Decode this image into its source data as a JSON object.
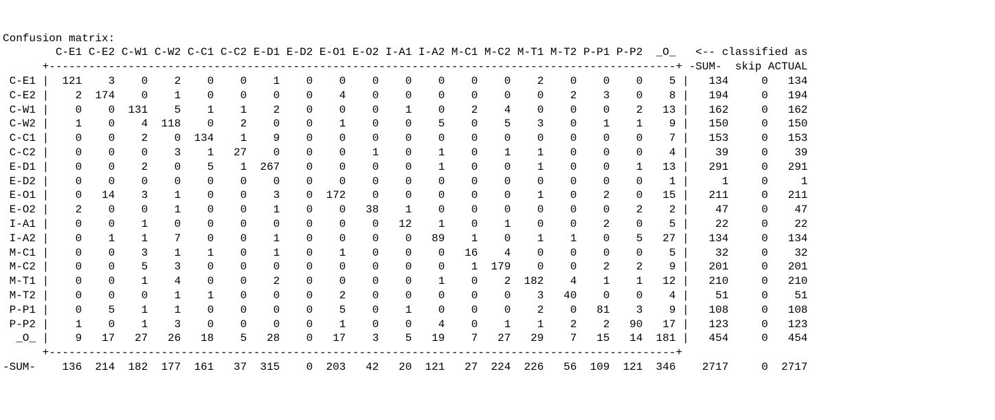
{
  "title": "Confusion matrix:",
  "classified_as": "<-- classified as",
  "col_labels": [
    "C-E1",
    "C-E2",
    "C-W1",
    "C-W2",
    "C-C1",
    "C-C2",
    "E-D1",
    "E-D2",
    "E-O1",
    "E-O2",
    "I-A1",
    "I-A2",
    "M-C1",
    "M-C2",
    "M-T1",
    "M-T2",
    "P-P1",
    "P-P2",
    "_O_"
  ],
  "sum_cols": [
    "-SUM-",
    "skip",
    "ACTUAL"
  ],
  "row_labels": [
    "C-E1",
    "C-E2",
    "C-W1",
    "C-W2",
    "C-C1",
    "C-C2",
    "E-D1",
    "E-D2",
    "E-O1",
    "E-O2",
    "I-A1",
    "I-A2",
    "M-C1",
    "M-C2",
    "M-T1",
    "M-T2",
    "P-P1",
    "P-P2",
    "_O_"
  ],
  "matrix": [
    [
      121,
      3,
      0,
      2,
      0,
      0,
      1,
      0,
      0,
      0,
      0,
      0,
      0,
      0,
      2,
      0,
      0,
      0,
      5
    ],
    [
      2,
      174,
      0,
      1,
      0,
      0,
      0,
      0,
      4,
      0,
      0,
      0,
      0,
      0,
      0,
      2,
      3,
      0,
      8
    ],
    [
      0,
      0,
      131,
      5,
      1,
      1,
      2,
      0,
      0,
      0,
      1,
      0,
      2,
      4,
      0,
      0,
      0,
      2,
      13
    ],
    [
      1,
      0,
      4,
      118,
      0,
      2,
      0,
      0,
      1,
      0,
      0,
      5,
      0,
      5,
      3,
      0,
      1,
      1,
      9
    ],
    [
      0,
      0,
      2,
      0,
      134,
      1,
      9,
      0,
      0,
      0,
      0,
      0,
      0,
      0,
      0,
      0,
      0,
      0,
      7
    ],
    [
      0,
      0,
      0,
      3,
      1,
      27,
      0,
      0,
      0,
      1,
      0,
      1,
      0,
      1,
      1,
      0,
      0,
      0,
      4
    ],
    [
      0,
      0,
      2,
      0,
      5,
      1,
      267,
      0,
      0,
      0,
      0,
      1,
      0,
      0,
      1,
      0,
      0,
      1,
      13
    ],
    [
      0,
      0,
      0,
      0,
      0,
      0,
      0,
      0,
      0,
      0,
      0,
      0,
      0,
      0,
      0,
      0,
      0,
      0,
      1
    ],
    [
      0,
      14,
      3,
      1,
      0,
      0,
      3,
      0,
      172,
      0,
      0,
      0,
      0,
      0,
      1,
      0,
      2,
      0,
      15
    ],
    [
      2,
      0,
      0,
      1,
      0,
      0,
      1,
      0,
      0,
      38,
      1,
      0,
      0,
      0,
      0,
      0,
      0,
      2,
      2
    ],
    [
      0,
      0,
      1,
      0,
      0,
      0,
      0,
      0,
      0,
      0,
      12,
      1,
      0,
      1,
      0,
      0,
      2,
      0,
      5
    ],
    [
      0,
      1,
      1,
      7,
      0,
      0,
      1,
      0,
      0,
      0,
      0,
      89,
      1,
      0,
      1,
      1,
      0,
      5,
      27
    ],
    [
      0,
      0,
      3,
      1,
      1,
      0,
      1,
      0,
      1,
      0,
      0,
      0,
      16,
      4,
      0,
      0,
      0,
      0,
      5
    ],
    [
      0,
      0,
      5,
      3,
      0,
      0,
      0,
      0,
      0,
      0,
      0,
      0,
      1,
      179,
      0,
      0,
      2,
      2,
      9
    ],
    [
      0,
      0,
      1,
      4,
      0,
      0,
      2,
      0,
      0,
      0,
      0,
      1,
      0,
      2,
      182,
      4,
      1,
      1,
      12
    ],
    [
      0,
      0,
      0,
      1,
      1,
      0,
      0,
      0,
      2,
      0,
      0,
      0,
      0,
      0,
      3,
      40,
      0,
      0,
      4
    ],
    [
      0,
      5,
      1,
      1,
      0,
      0,
      0,
      0,
      5,
      0,
      1,
      0,
      0,
      0,
      2,
      0,
      81,
      3,
      9
    ],
    [
      1,
      0,
      1,
      3,
      0,
      0,
      0,
      0,
      1,
      0,
      0,
      4,
      0,
      1,
      1,
      2,
      2,
      90,
      17
    ],
    [
      9,
      17,
      27,
      26,
      18,
      5,
      28,
      0,
      17,
      3,
      5,
      19,
      7,
      27,
      29,
      7,
      15,
      14,
      181
    ]
  ],
  "row_sums": [
    [
      134,
      0,
      134
    ],
    [
      194,
      0,
      194
    ],
    [
      162,
      0,
      162
    ],
    [
      150,
      0,
      150
    ],
    [
      153,
      0,
      153
    ],
    [
      39,
      0,
      39
    ],
    [
      291,
      0,
      291
    ],
    [
      1,
      0,
      1
    ],
    [
      211,
      0,
      211
    ],
    [
      47,
      0,
      47
    ],
    [
      22,
      0,
      22
    ],
    [
      134,
      0,
      134
    ],
    [
      32,
      0,
      32
    ],
    [
      201,
      0,
      201
    ],
    [
      210,
      0,
      210
    ],
    [
      51,
      0,
      51
    ],
    [
      108,
      0,
      108
    ],
    [
      123,
      0,
      123
    ],
    [
      454,
      0,
      454
    ]
  ],
  "col_sums_label": "-SUM-",
  "col_sums": [
    136,
    214,
    182,
    177,
    161,
    37,
    315,
    0,
    203,
    42,
    20,
    121,
    27,
    224,
    226,
    56,
    109,
    121,
    346
  ],
  "grand_sums": [
    2717,
    0,
    2717
  ]
}
